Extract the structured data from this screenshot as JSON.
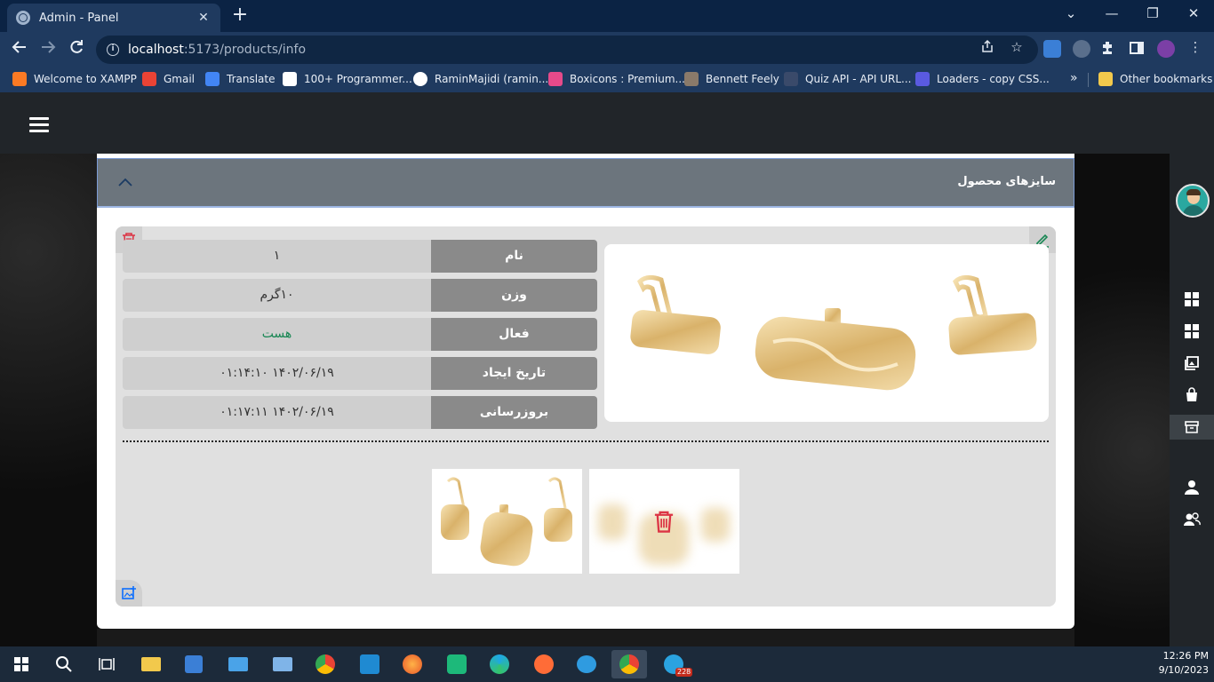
{
  "browser": {
    "tab_title": "Admin - Panel",
    "tab_close": "✕",
    "new_tab": "+",
    "url_host": "localhost",
    "url_path": ":5173/products/info",
    "window_controls": {
      "minimize": "⌄",
      "restore": "—",
      "maximize": "❐",
      "close": "✕"
    },
    "bookmarks": [
      {
        "label": "Welcome to XAMPP",
        "color": "#fb7a24"
      },
      {
        "label": "Gmail",
        "color": "#ea4335"
      },
      {
        "label": "Translate",
        "color": "#4285f4"
      },
      {
        "label": "100+ Programmer...",
        "color": "#ffffff"
      },
      {
        "label": "RaminMajidi (ramin...",
        "color": "#ffffff"
      },
      {
        "label": "Boxicons : Premium...",
        "color": "#e64a8a"
      },
      {
        "label": "Bennett Feely",
        "color": "#8a7a6a"
      },
      {
        "label": "Quiz API - API URL...",
        "color": "#3a4a6a"
      },
      {
        "label": "Loaders - copy CSS...",
        "color": "#5a5ae0"
      }
    ],
    "bookmarks_more": "»",
    "other_bookmarks": "Other bookmarks"
  },
  "panel": {
    "section_title": "سایزهای محصول",
    "rows": [
      {
        "label": "نام",
        "value": "۱"
      },
      {
        "label": "وزن",
        "value": "۱۰گرم"
      },
      {
        "label": "فعال",
        "value": "هست"
      },
      {
        "label": "تاریخ ایجاد",
        "value": "۱۴۰۲/۰۶/۱۹ ۰۱:۱۴:۱۰"
      },
      {
        "label": "بروزرسانی",
        "value": "۱۴۰۲/۰۶/۱۹ ۰۱:۱۷:۱۱"
      }
    ]
  },
  "taskbar": {
    "time": "12:26 PM",
    "date": "9/10/2023",
    "telegram_badge": "228"
  },
  "colors": {
    "accent_delete": "#dc3545",
    "accent_edit": "#198754",
    "accent_add": "#0d6efd",
    "status_active": "#198754"
  }
}
